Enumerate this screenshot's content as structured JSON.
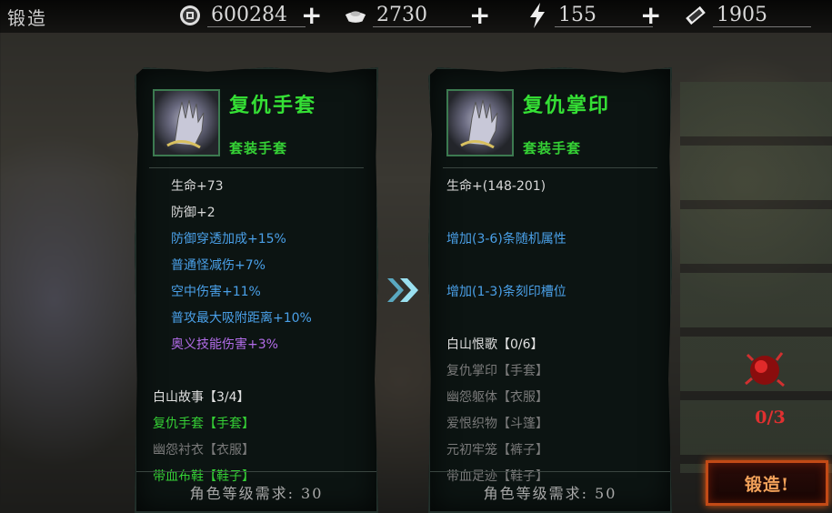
{
  "header": {
    "title": "锻造",
    "resources": [
      {
        "icon": "coin-icon",
        "value": "600284"
      },
      {
        "icon": "ingot-icon",
        "value": "2730"
      },
      {
        "icon": "lightning-icon",
        "value": "155"
      },
      {
        "icon": "ticket-icon",
        "value": "1905"
      }
    ],
    "add_label": "+"
  },
  "current_item": {
    "name": "复仇手套",
    "type": "套装手套",
    "stats": [
      {
        "text": "生命+73",
        "color": "#d8d8d8"
      },
      {
        "text": "防御+2",
        "color": "#d8d8d8"
      },
      {
        "text": "防御穿透加成+15%",
        "color": "#4aa0e8"
      },
      {
        "text": "普通怪减伤+7%",
        "color": "#4aa0e8"
      },
      {
        "text": "空中伤害+11%",
        "color": "#4aa0e8"
      },
      {
        "text": "普攻最大吸附距离+10%",
        "color": "#4aa0e8"
      },
      {
        "text": "奥义技能伤害+3%",
        "color": "#b26ce8"
      }
    ],
    "set_name": "白山故事【3/4】",
    "set_items": [
      {
        "text": "复仇手套【手套】",
        "color": "#35d035"
      },
      {
        "text": "幽怨衬衣【衣服】",
        "color": "#7a7a7a"
      },
      {
        "text": "带血布鞋【鞋子】",
        "color": "#35d035"
      }
    ],
    "level_req": "角色等级需求: 30"
  },
  "result_item": {
    "name": "复仇掌印",
    "type": "套装手套",
    "stats": [
      {
        "text": "生命+(148-201)",
        "color": "#d8d8d8"
      },
      {
        "text": "增加(3-6)条随机属性",
        "color": "#4aa0e8"
      },
      {
        "text": "增加(1-3)条刻印槽位",
        "color": "#4aa0e8"
      }
    ],
    "set_name": "白山恨歌【0/6】",
    "set_items": [
      {
        "text": "复仇掌印【手套】",
        "color": "#7a7a7a"
      },
      {
        "text": "幽怨躯体【衣服】",
        "color": "#7a7a7a"
      },
      {
        "text": "爱恨织物【斗篷】",
        "color": "#7a7a7a"
      },
      {
        "text": "元初牢笼【裤子】",
        "color": "#7a7a7a"
      },
      {
        "text": "带血足迹【鞋子】",
        "color": "#7a7a7a"
      }
    ],
    "level_req": "角色等级需求: 50"
  },
  "forge": {
    "material_count": "0/3",
    "button_label": "锻造!"
  },
  "colors": {
    "accent_green": "#35e035",
    "stat_blue": "#4aa0e8",
    "stat_purple": "#b26ce8",
    "forge_orange": "#c24a16",
    "count_red": "#e03030"
  }
}
